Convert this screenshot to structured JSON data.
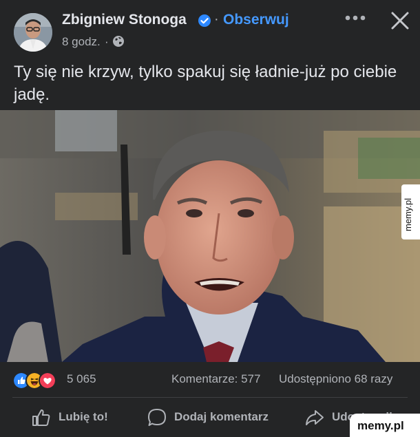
{
  "post": {
    "author": "Zbigniew Stonoga",
    "verified_icon": "verified-badge-icon",
    "separator": "·",
    "follow_label": "Obserwuj",
    "time": "8 godz.",
    "time_separator": "·",
    "audience_icon": "globe-icon",
    "text": "Ty się nie krzyw, tylko spakuj się ładnie-już po ciebie jadę.",
    "image": "photo of a man in a dark suit speaking at a meeting"
  },
  "header_actions": {
    "more_icon": "more-horizontal-icon",
    "close_icon": "close-icon"
  },
  "stats": {
    "reaction_icons": [
      "like-reaction-icon",
      "haha-reaction-icon",
      "love-reaction-icon"
    ],
    "reaction_count": "5 065",
    "comments": "Komentarze: 577",
    "shares": "Udostępniono 68 razy"
  },
  "actions": {
    "like_label": "Lubię to!",
    "comment_label": "Dodaj komentarz",
    "share_label": "Udostępnij"
  },
  "watermarks": {
    "side": "memy.pl",
    "bottom": "memy.pl"
  },
  "colors": {
    "background": "#242526",
    "text": "#e4e6eb",
    "secondary_text": "#b0b3b8",
    "link": "#4599ff",
    "like_blue": "#2d88ff",
    "love_red": "#f33e58",
    "haha_yellow": "#f7b125"
  }
}
